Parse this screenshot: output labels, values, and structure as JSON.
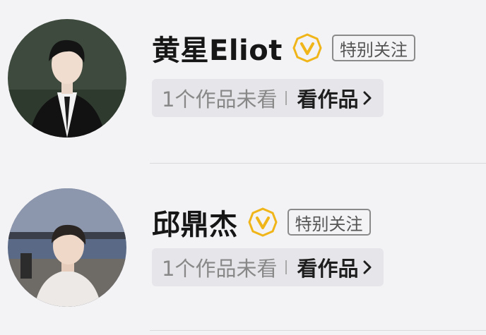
{
  "users": [
    {
      "name": "黄星Eliot",
      "follow_tag": "特别关注",
      "unread_text": "1个作品未看",
      "works_link": "看作品"
    },
    {
      "name": "邱鼎杰",
      "follow_tag": "特别关注",
      "unread_text": "1个作品未看",
      "works_link": "看作品"
    }
  ],
  "colors": {
    "verified_badge": "#f0b519",
    "background": "#f3f2f5"
  },
  "icons": [
    "avatar",
    "verified-v-icon",
    "chevron-right-icon"
  ]
}
